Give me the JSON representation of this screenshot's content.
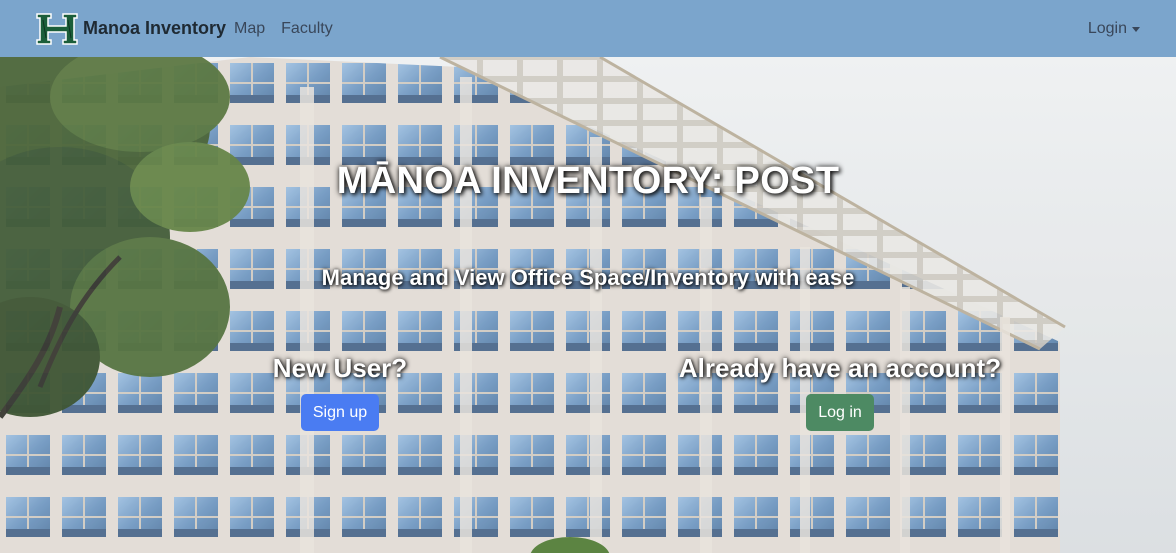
{
  "navbar": {
    "brand": "Manoa Inventory",
    "links": [
      "Map",
      "Faculty"
    ],
    "login_label": "Login",
    "logo_icon": "manoa-h-logo-icon",
    "background": "#7ba5cc"
  },
  "hero": {
    "title": "MĀNOA INVENTORY: POST",
    "subtitle": "Manage and View Office Space/Inventory with ease",
    "new_user": {
      "heading": "New User?",
      "button_label": "Sign up",
      "button_color": "#4a7cf2"
    },
    "existing_user": {
      "heading": "Already have an account?",
      "button_label": "Log in",
      "button_color": "#4d8a63"
    }
  }
}
